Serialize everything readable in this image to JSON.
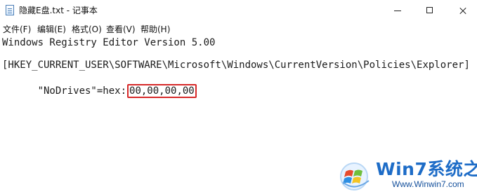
{
  "window": {
    "title": "隐藏E盘.txt - 记事本"
  },
  "menu": {
    "items": [
      "文件(F)",
      "编辑(E)",
      "格式(O)",
      "查看(V)",
      "帮助(H)"
    ]
  },
  "editor": {
    "lines": [
      "Windows Registry Editor Version 5.00",
      "[HKEY_CURRENT_USER\\SOFTWARE\\Microsoft\\Windows\\CurrentVersion\\Policies\\Explorer]",
      "\"NoDrives\"=hex:",
      "00,00,00,00"
    ]
  },
  "watermark": {
    "title": "Win7系统之家",
    "site": "Www.Winwin7.com"
  },
  "colors": {
    "highlight_border": "#d62828",
    "watermark_blue": "#1d6cc7"
  },
  "icons": {
    "app": "notepad-icon",
    "minimize": "minimize-icon",
    "maximize": "maximize-icon",
    "close": "close-icon",
    "watermark_logo": "windows-logo-icon"
  }
}
